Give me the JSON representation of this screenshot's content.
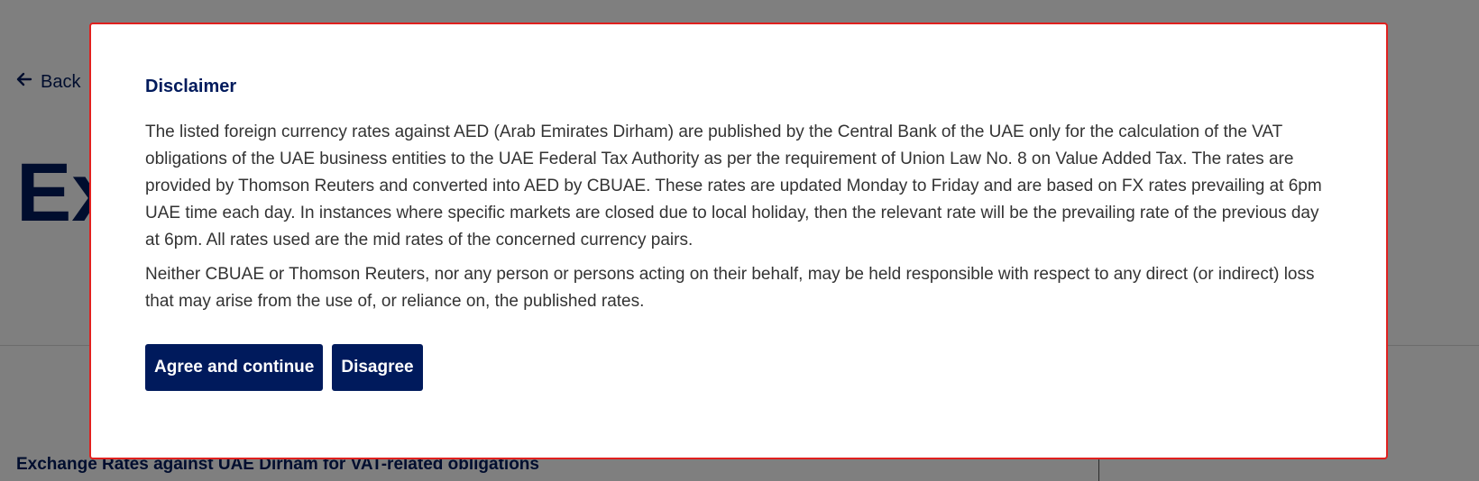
{
  "background_page": {
    "back_label": "Back",
    "page_title": "Ex",
    "section_heading": "Exchange Rates against UAE Dirham for VAT-related obligations"
  },
  "modal": {
    "title": "Disclaimer",
    "paragraph_1": "The listed foreign currency rates against AED (Arab Emirates Dirham) are published by the Central Bank of the UAE only for the calculation of the VAT obligations of the UAE business entities to the UAE Federal Tax Authority as per the requirement of Union Law No. 8 on Value Added Tax. The rates are provided by Thomson Reuters and converted into AED by CBUAE. These rates are updated Monday to Friday and are based on FX rates prevailing at 6pm UAE time each day. In instances where specific markets are closed due to local holiday, then the relevant rate will be the prevailing rate of the previous day at 6pm. All rates used are the mid rates of the concerned currency pairs.",
    "paragraph_2": "Neither CBUAE or Thomson Reuters, nor any person or persons acting on their behalf, may be held responsible with respect to any direct (or indirect) loss that may arise from the use of, or reliance on, the published rates.",
    "agree_label": "Agree and continue",
    "disagree_label": "Disagree"
  },
  "colors": {
    "brand_navy": "#001a5c",
    "modal_border": "#e0201e",
    "overlay": "rgba(0,0,0,0.5)"
  },
  "icons": {
    "back": "arrow-left-icon"
  }
}
